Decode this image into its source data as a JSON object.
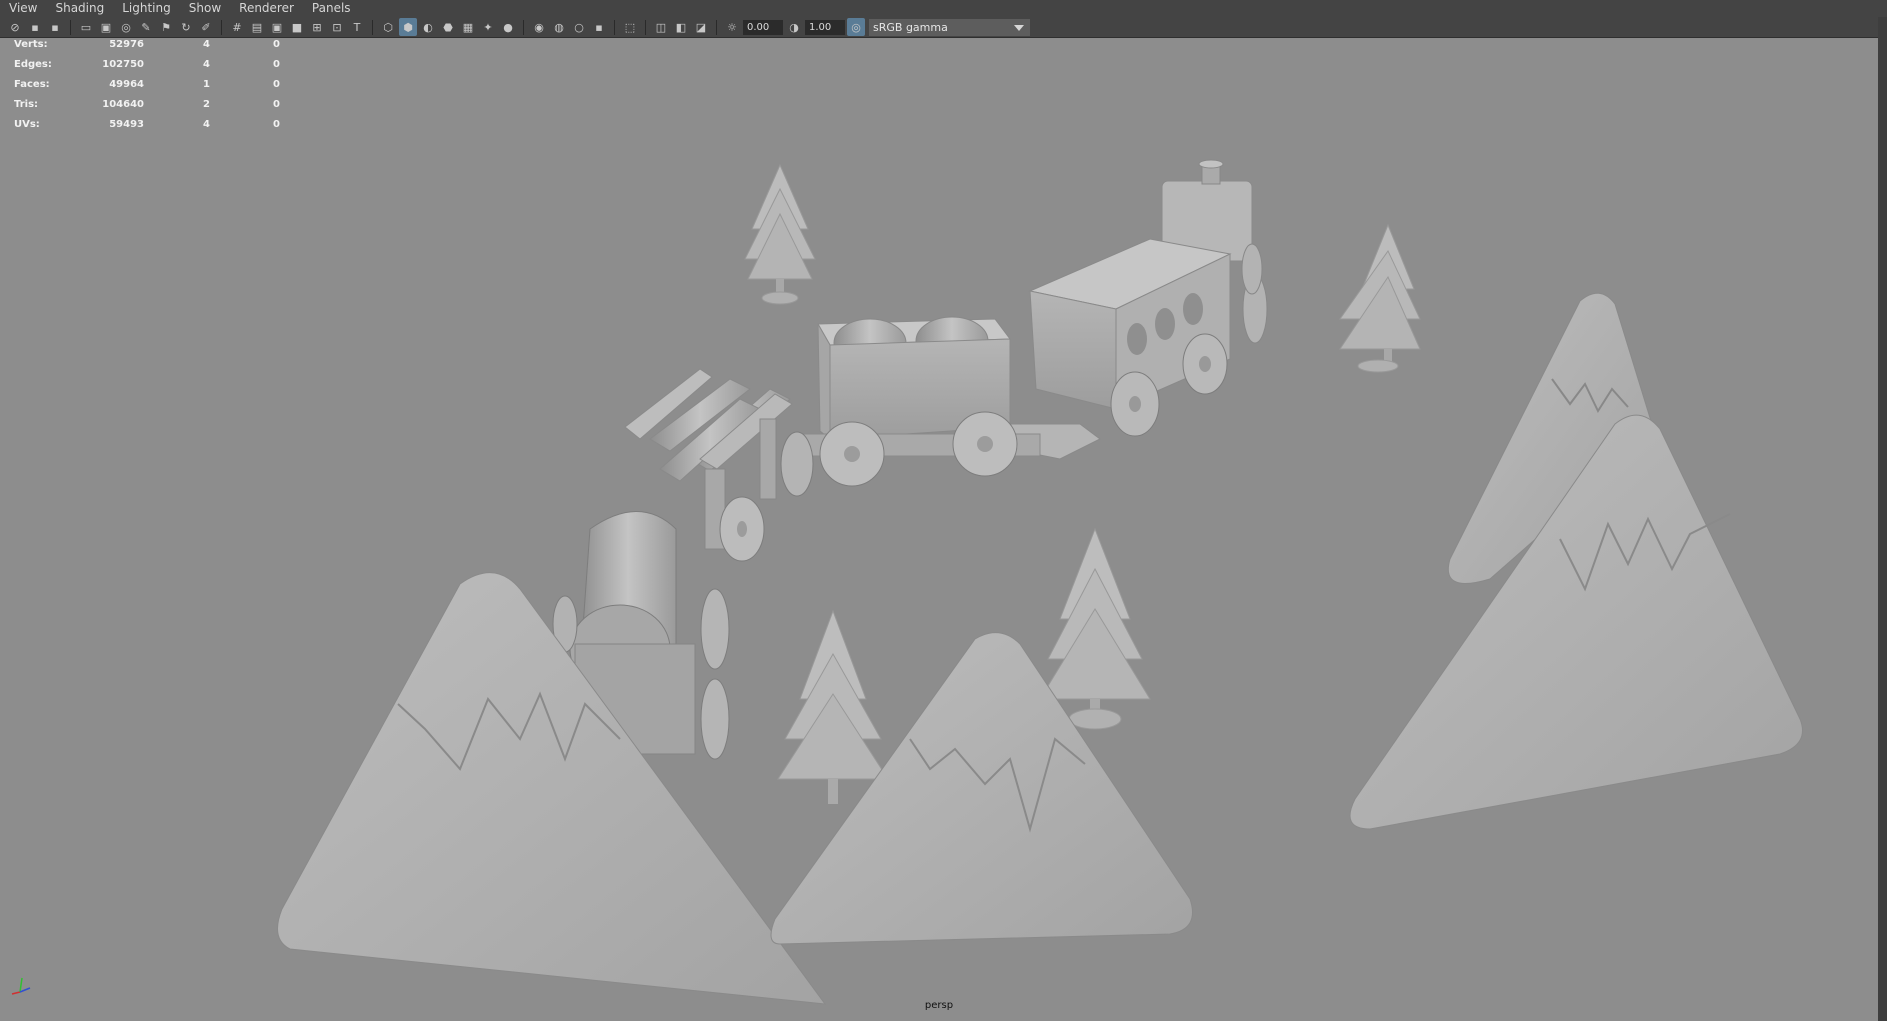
{
  "menu": [
    "View",
    "Shading",
    "Lighting",
    "Show",
    "Renderer",
    "Panels"
  ],
  "toolbar": {
    "exposure": "0.00",
    "gamma": "1.00",
    "color_space": "sRGB gamma"
  },
  "hud": {
    "rows": [
      {
        "label": "Verts:",
        "total": "52976",
        "selected": "4",
        "uv": "0"
      },
      {
        "label": "Edges:",
        "total": "102750",
        "selected": "4",
        "uv": "0"
      },
      {
        "label": "Faces:",
        "total": "49964",
        "selected": "1",
        "uv": "0"
      },
      {
        "label": "Tris:",
        "total": "104640",
        "selected": "2",
        "uv": "0"
      },
      {
        "label": "UVs:",
        "total": "59493",
        "selected": "4",
        "uv": "0"
      }
    ]
  },
  "camera_label": "persp",
  "colors": {
    "menubar_bg": "#444444",
    "viewport_bg": "#8d8d8d",
    "accent": "#5a7c96"
  }
}
